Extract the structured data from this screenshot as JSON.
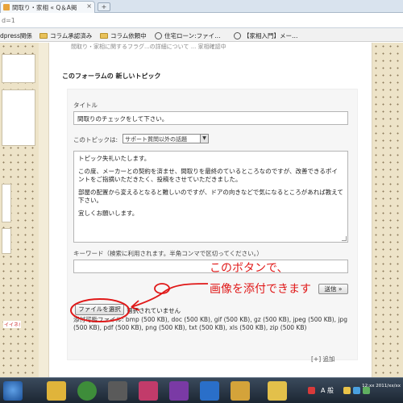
{
  "browser": {
    "tab_title": "間取り・家相 « Q＆A掲",
    "tab_close": "×",
    "new_tab": "+",
    "url_fragment": "d=1"
  },
  "bookmarks": [
    {
      "label": "dpress関係",
      "icon": "folder-icon"
    },
    {
      "label": "コラム承認済み",
      "icon": "folder-icon"
    },
    {
      "label": "コラム依頼中",
      "icon": "folder-icon"
    },
    {
      "label": "住宅ローン:ファイ…",
      "icon": "site-icon"
    },
    {
      "label": "【家相入門】メー…",
      "icon": "site-icon"
    }
  ],
  "page": {
    "truncated_top_text": "間取り・家相に関するフラグ...の詳細について ... 家相確認中",
    "section_title": "このフォーラムの 新しいトピック",
    "left_tag": "イイネ!"
  },
  "form": {
    "title_label": "タイトル",
    "title_value": "間取りのチェックをして下さい。",
    "topic_label": "このトピックは:",
    "topic_select_value": "サポート質問以外の話題",
    "topic_select_arrow": "▼",
    "body_paragraphs": [
      "トピック失礼いたします。",
      "この度、メーカーとの契約を済ませ、間取りを最終のているところなのですが、改善できるポイントをご指摘いただきたく、投稿をさせていただきました。",
      "部屋の配置から変えるとなると難しいのですが、ドアの向きなどで気になるところがあれば教えて下さい。",
      "宜しくお願いします。"
    ],
    "keyword_label": "キーワード（検索に利用されます。半角コンマで区切ってください。）",
    "keyword_value": "",
    "submit_label": "送信 »",
    "file_button_label": "ファイルを選択",
    "file_status": "選択されていません",
    "allowed_files_text": "添付可能ファイル: bmp (500 KB), doc (500 KB), gif (500 KB), gz (500 KB), jpeg (500 KB), jpg (500 KB), pdf (500 KB), png (500 KB), txt (500 KB), xls (500 KB), zip (500 KB)",
    "add_link": "[+] 追加"
  },
  "annotation": {
    "line1": "このボタンで、",
    "line2": "画像を添付できます",
    "color": "#e01818"
  },
  "taskbar": {
    "ime_label": "A 般",
    "clock": "12:xx\n2011/xx/xx"
  }
}
